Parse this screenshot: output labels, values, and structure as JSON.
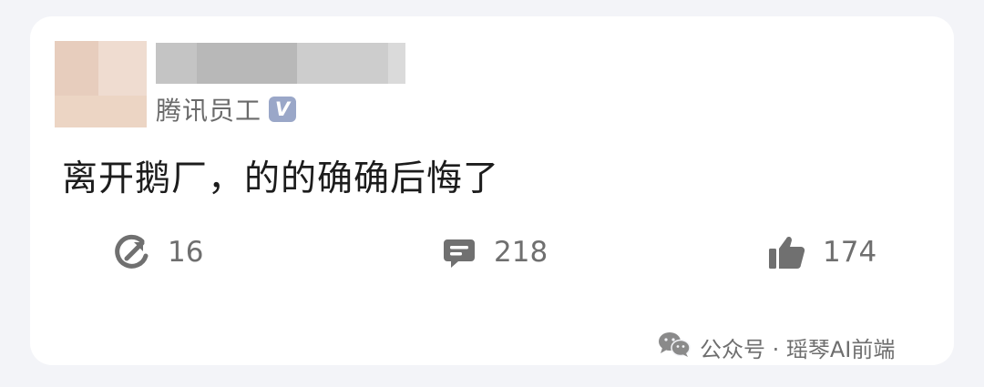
{
  "post": {
    "author": {
      "name_obscured": true,
      "badge_label": "腾讯员工",
      "verified_mark": "V"
    },
    "content": "离开鹅厂，的的确确后悔了",
    "actions": {
      "repost": {
        "icon": "repost-icon",
        "count": "16"
      },
      "comment": {
        "icon": "comment-icon",
        "count": "218"
      },
      "like": {
        "icon": "thumbs-up-icon",
        "count": "174"
      }
    }
  },
  "watermark": {
    "icon": "wechat-icon",
    "text": "公众号 · 瑶琴AI前端"
  },
  "colors": {
    "background": "#f3f4f8",
    "card": "#ffffff",
    "icon": "#707070",
    "verified_badge": "#9aa7c8"
  }
}
